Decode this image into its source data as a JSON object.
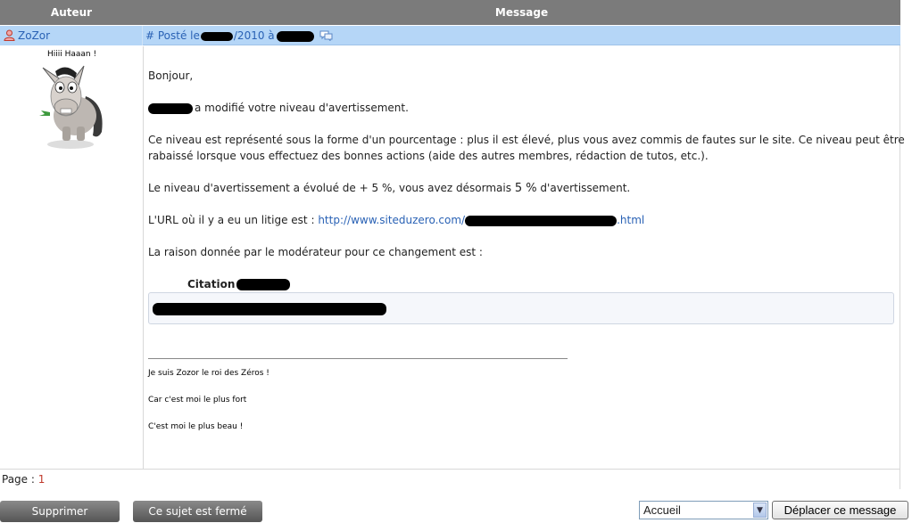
{
  "header": {
    "author_col": "Auteur",
    "message_col": "Message"
  },
  "post": {
    "author": "ZoZor",
    "posted_prefix": "# Posté le",
    "posted_year": "/2010 à",
    "motto": "Hiiii Haaan !",
    "greeting": "Bonjour,",
    "modified_text": "a modifié votre niveau d'avertissement.",
    "explain_line1": "Ce niveau est représenté sous la forme d'un pourcentage : plus il est élevé, plus vous avez commis de fautes sur le site. Ce niveau peut être",
    "explain_line2": "rabaissé lorsque vous effectuez des bonnes actions (aide des autres membres, rédaction de tutos, etc.).",
    "evolution_prefix": "Le niveau d'avertissement a évolué de + 5 %, vous avez désormais",
    "evolution_value": "5 %",
    "evolution_suffix": "d'avertissement.",
    "url_prefix": "L'URL où il y a eu un litige est :",
    "url_start": "http://www.siteduzero.com/",
    "url_end": ".html",
    "reason_text": "La raison donnée par le modérateur pour ce changement est :",
    "citation_label": "Citation",
    "signature": [
      "Je suis Zozor le roi des Zéros !",
      "Car c'est moi le plus fort",
      "C'est moi le plus beau !"
    ]
  },
  "pagination": {
    "label": "Page :",
    "current": "1"
  },
  "actions": {
    "delete": "Supprimer",
    "closed": "Ce sujet est fermé",
    "move_select_value": "Accueil",
    "move_button": "Déplacer ce message"
  }
}
